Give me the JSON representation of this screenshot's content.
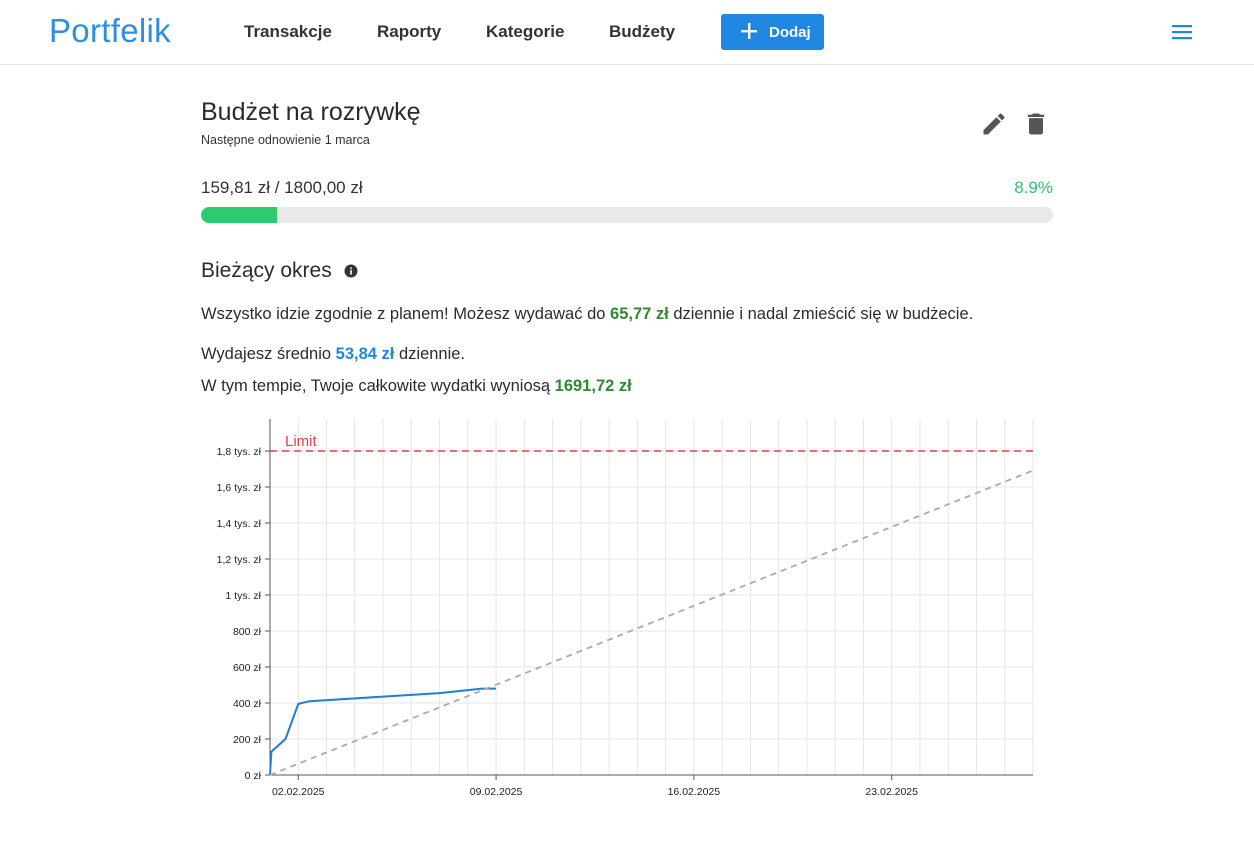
{
  "nav": {
    "logo": "Portfelik",
    "links": [
      "Transakcje",
      "Raporty",
      "Kategorie",
      "Budżety"
    ],
    "add_button": "Dodaj",
    "icons": {
      "add": "plus-icon",
      "menu": "hamburger-menu-icon"
    }
  },
  "budget": {
    "title": "Budżet na rozrywkę",
    "renewal": "Następne odnowienie 1 marca",
    "spent": "159,81 zł",
    "separator": " / ",
    "limit": "1800,00 zł",
    "percent": "8.9%",
    "progress_fraction": 0.089,
    "icons": {
      "edit": "pencil-icon",
      "delete": "trash-icon"
    }
  },
  "period": {
    "title": "Bieżący okres",
    "info_icon": "info-icon",
    "msg1_pre": "Wszystko idzie zgodnie z planem! Możesz wydawać do ",
    "msg1_value": "65,77 zł",
    "msg1_post": " dziennie i nadal zmieścić się w budżecie.",
    "msg2_pre": "Wydajesz średnio ",
    "msg2_value": "53,84 zł",
    "msg2_post": " dziennie.",
    "msg3_pre": "W tym tempie, Twoje całkowite wydatki wyniosą ",
    "msg3_value": "1691,72 zł"
  },
  "colors": {
    "brand": "#2e8ee0",
    "green_text": "#2e8b2e",
    "progress": "#2dcb70",
    "blue_text": "#1f86e2",
    "limit": "#e0424a",
    "actual_line": "#1f7fd4",
    "projection_line": "#aaaaaa"
  },
  "chart_data": {
    "type": "line",
    "ylim": [
      0,
      1800
    ],
    "xlim": [
      "2025-02-01",
      "2025-02-28"
    ],
    "y_ticks": [
      {
        "value": 0,
        "label": "0 zł"
      },
      {
        "value": 200,
        "label": "200 zł"
      },
      {
        "value": 400,
        "label": "400 zł"
      },
      {
        "value": 600,
        "label": "600 zł"
      },
      {
        "value": 800,
        "label": "800 zł"
      },
      {
        "value": 1000,
        "label": "1 tys. zł"
      },
      {
        "value": 1200,
        "label": "1,2 tys. zł"
      },
      {
        "value": 1400,
        "label": "1,4 tys. zł"
      },
      {
        "value": 1600,
        "label": "1,6 tys. zł"
      },
      {
        "value": 1800,
        "label": "1,8 tys. zł"
      }
    ],
    "x_ticks": [
      {
        "date": "2025-02-02",
        "label": "02.02.2025"
      },
      {
        "date": "2025-02-09",
        "label": "09.02.2025"
      },
      {
        "date": "2025-02-16",
        "label": "16.02.2025"
      },
      {
        "date": "2025-02-23",
        "label": "23.02.2025"
      }
    ],
    "limit": {
      "value": 1800,
      "label": "Limit"
    },
    "grid": true,
    "series": [
      {
        "style": "solid",
        "points": [
          {
            "date": "2025-02-01",
            "value": 0
          },
          {
            "date": "2025-02-01",
            "value": 130
          },
          {
            "date": "2025-02-01",
            "value": 200
          },
          {
            "date": "2025-02-02",
            "value": 395
          },
          {
            "date": "2025-02-02",
            "value": 410
          },
          {
            "date": "2025-02-07",
            "value": 455
          },
          {
            "date": "2025-02-08",
            "value": 480
          },
          {
            "date": "2025-02-09",
            "value": 480
          }
        ]
      },
      {
        "style": "dashed",
        "points": [
          {
            "date": "2025-02-01",
            "value": 0
          },
          {
            "date": "2025-02-28",
            "value": 1691.72
          }
        ]
      }
    ]
  }
}
